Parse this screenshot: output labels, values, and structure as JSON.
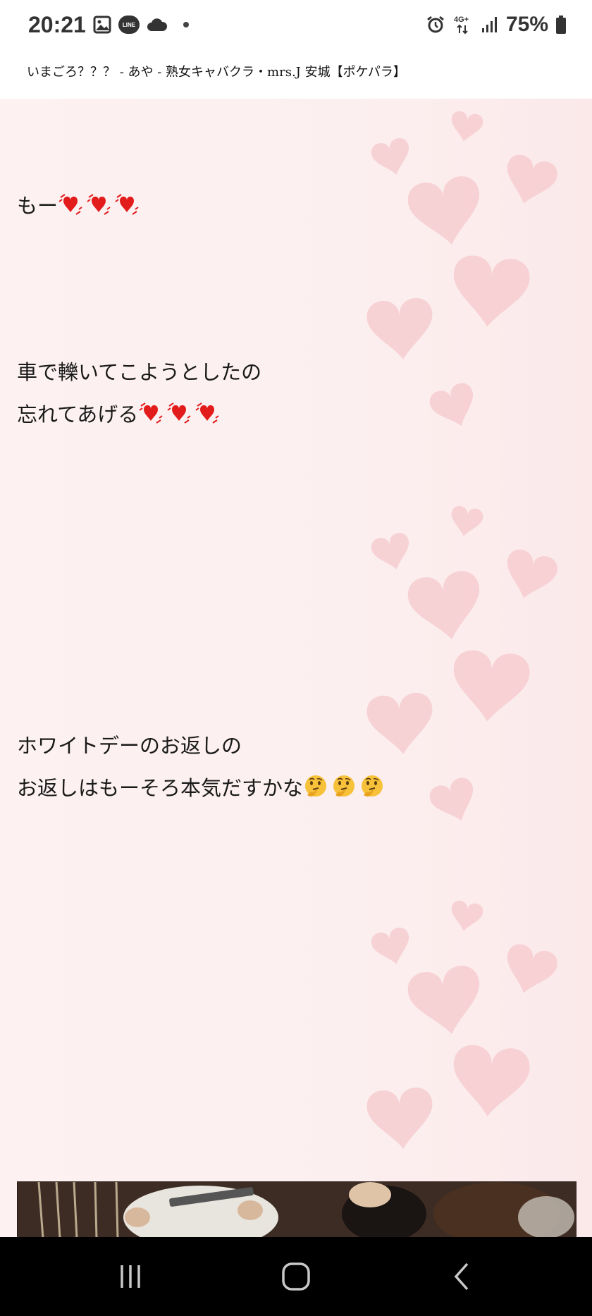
{
  "status_bar": {
    "time": "20:21",
    "line_label": "LINE",
    "network": "4G+",
    "battery": "75%",
    "icons_left": [
      "gallery-icon",
      "line-icon",
      "cloud-icon",
      "dot-icon"
    ],
    "icons_right": [
      "alarm-icon",
      "network-4g-icon",
      "signal-icon",
      "battery-icon"
    ]
  },
  "header": {
    "title": "いまごろ？？？ - あや - 熟女キャバクラ・mrs.J 安城【ポケパラ】"
  },
  "post": {
    "paragraph1": {
      "line1": "もー"
    },
    "paragraph2": {
      "line1": "車で轢いてこようとしたの",
      "line2": "忘れてあげる"
    },
    "paragraph3": {
      "line1": "ホワイトデーのお返しの",
      "line2": "お返しはもーそろ本気だすかな"
    },
    "emoji": {
      "heart": "revolving-hearts-emoji",
      "thinking": "thinking-face-emoji"
    },
    "colors": {
      "background": "#fdf0f0",
      "heart_decor": "#f6c9cc",
      "heart_emoji": "#e21b1b",
      "thinking_emoji": "#f7c23a"
    }
  },
  "nav_bar": {
    "buttons": [
      "recent-apps",
      "home",
      "back"
    ]
  }
}
